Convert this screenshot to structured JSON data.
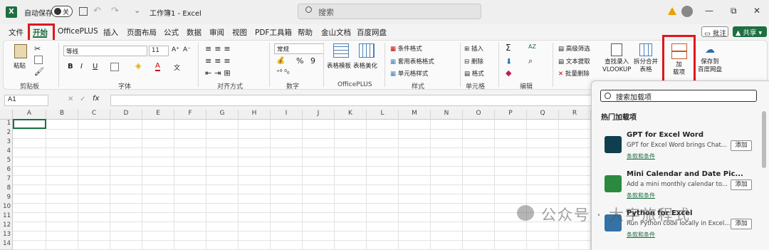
{
  "titlebar": {
    "logo": "X",
    "autosave": "自动保存",
    "toggle": "关",
    "title": "工作簿1 - Excel",
    "search_placeholder": "搜索",
    "minimize": "—",
    "restore": "⧉",
    "close": "✕"
  },
  "menu": [
    "文件",
    "开始",
    "OfficePLUS",
    "插入",
    "页面布局",
    "公式",
    "数据",
    "审阅",
    "视图",
    "PDF工具箱",
    "帮助",
    "金山文档",
    "百度网盘"
  ],
  "comment": "▭ 批注",
  "share": "▲ 共享 ▾",
  "ribbon": {
    "clipboard": {
      "paste": "粘贴",
      "label": "剪贴板"
    },
    "font": {
      "name": "等线",
      "size": "11",
      "label": "字体",
      "bold": "B",
      "italic": "I",
      "underline": "U",
      "grow": "A⁺",
      "shrink": "A⁻",
      "fontcolor": "A",
      "wen": "文"
    },
    "align": {
      "label": "对齐方式"
    },
    "number": {
      "format": "常规",
      "label": "数字",
      "pct": "%",
      "comma": "9"
    },
    "officeplus": {
      "template": "表格模板",
      "beautify": "表格美化",
      "label": "OfficePLUS"
    },
    "styles": {
      "cond": "条件格式",
      "table": "套用表格格式",
      "cell": "单元格样式",
      "label": "样式"
    },
    "cells": {
      "insert": "插入",
      "delete": "删除",
      "format": "格式",
      "label": "单元格"
    },
    "edit": {
      "label": "编辑",
      "sigma": "Σ",
      "sort": "AZ"
    },
    "filter": {
      "adv": "高级筛选",
      "extract": "文本提取",
      "batchdel": "批量删除"
    },
    "lookup": "查找录入\nVLOOKUP",
    "split": "拆分合并\n表格",
    "addins": "加\n载项",
    "baidu": "保存到\n百度网盘"
  },
  "formula": {
    "cell": "A1",
    "fx": "fx"
  },
  "columns": [
    "A",
    "B",
    "C",
    "D",
    "E",
    "F",
    "G",
    "H",
    "I",
    "J",
    "K",
    "L",
    "M",
    "N",
    "O",
    "P",
    "Q",
    "R"
  ],
  "rows": [
    "1",
    "2",
    "3",
    "4",
    "5",
    "6",
    "7",
    "8",
    "9",
    "10",
    "11",
    "12",
    "13",
    "14"
  ],
  "pane": {
    "search_placeholder": "搜索加载项",
    "title": "热门加载项",
    "items": [
      {
        "name": "GPT for Excel Word",
        "desc": "GPT for Excel Word brings Chat...",
        "terms": "条款和条件",
        "add": "添加",
        "color": "#0f3f4f"
      },
      {
        "name": "Mini Calendar and Date Pic...",
        "desc": "Add a mini monthly calendar to...",
        "terms": "条款和条件",
        "add": "添加",
        "color": "#2b8a3e"
      },
      {
        "name": "Python for Excel",
        "desc": "Run Python code locally in Excel...",
        "terms": "条款和条件",
        "add": "添加",
        "color": "#3572a5"
      }
    ]
  },
  "watermark": "公众号 · 大宇旅程式",
  "colors": {
    "accent": "#1d6f42",
    "highlight": "#e0161b"
  }
}
